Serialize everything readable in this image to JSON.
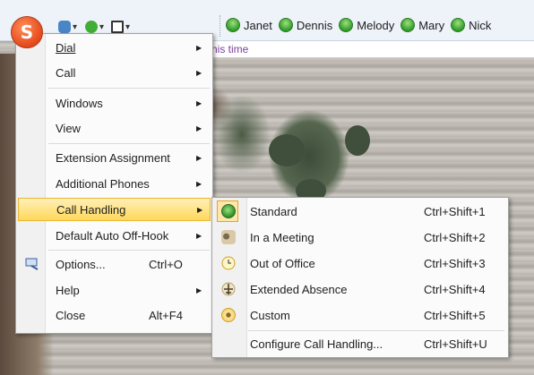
{
  "toolbar": {
    "contacts": [
      "Janet",
      "Dennis",
      "Melody",
      "Mary",
      "Nick"
    ],
    "status_text": "his time"
  },
  "main_menu": {
    "items": [
      {
        "label": "Dial",
        "shortcut": "",
        "submenu": true
      },
      {
        "label": "Call",
        "shortcut": "",
        "submenu": true
      },
      {
        "label": "Windows",
        "shortcut": "",
        "submenu": true
      },
      {
        "label": "View",
        "shortcut": "",
        "submenu": true
      },
      {
        "label": "Extension Assignment",
        "shortcut": "",
        "submenu": true
      },
      {
        "label": "Additional Phones",
        "shortcut": "",
        "submenu": true
      },
      {
        "label": "Call Handling",
        "shortcut": "",
        "submenu": true,
        "highlighted": true
      },
      {
        "label": "Default Auto Off-Hook",
        "shortcut": "",
        "submenu": true
      },
      {
        "label": "Options...",
        "shortcut": "Ctrl+O",
        "submenu": false
      },
      {
        "label": "Help",
        "shortcut": "",
        "submenu": true
      },
      {
        "label": "Close",
        "shortcut": "Alt+F4",
        "submenu": false
      }
    ]
  },
  "call_handling_menu": {
    "items": [
      {
        "label": "Standard",
        "shortcut": "Ctrl+Shift+1",
        "icon": "standard-status-icon",
        "checked": true
      },
      {
        "label": "In a Meeting",
        "shortcut": "Ctrl+Shift+2",
        "icon": "meeting-icon"
      },
      {
        "label": "Out of Office",
        "shortcut": "Ctrl+Shift+3",
        "icon": "clock-icon"
      },
      {
        "label": "Extended Absence",
        "shortcut": "Ctrl+Shift+4",
        "icon": "airplane-icon"
      },
      {
        "label": "Custom",
        "shortcut": "Ctrl+Shift+5",
        "icon": "custom-icon"
      },
      {
        "label": "Configure Call Handling...",
        "shortcut": "Ctrl+Shift+U",
        "icon": ""
      }
    ]
  },
  "colors": {
    "highlight": "#ffd85b",
    "app_button": "#e5481b",
    "status_text": "#7a3f9a"
  }
}
